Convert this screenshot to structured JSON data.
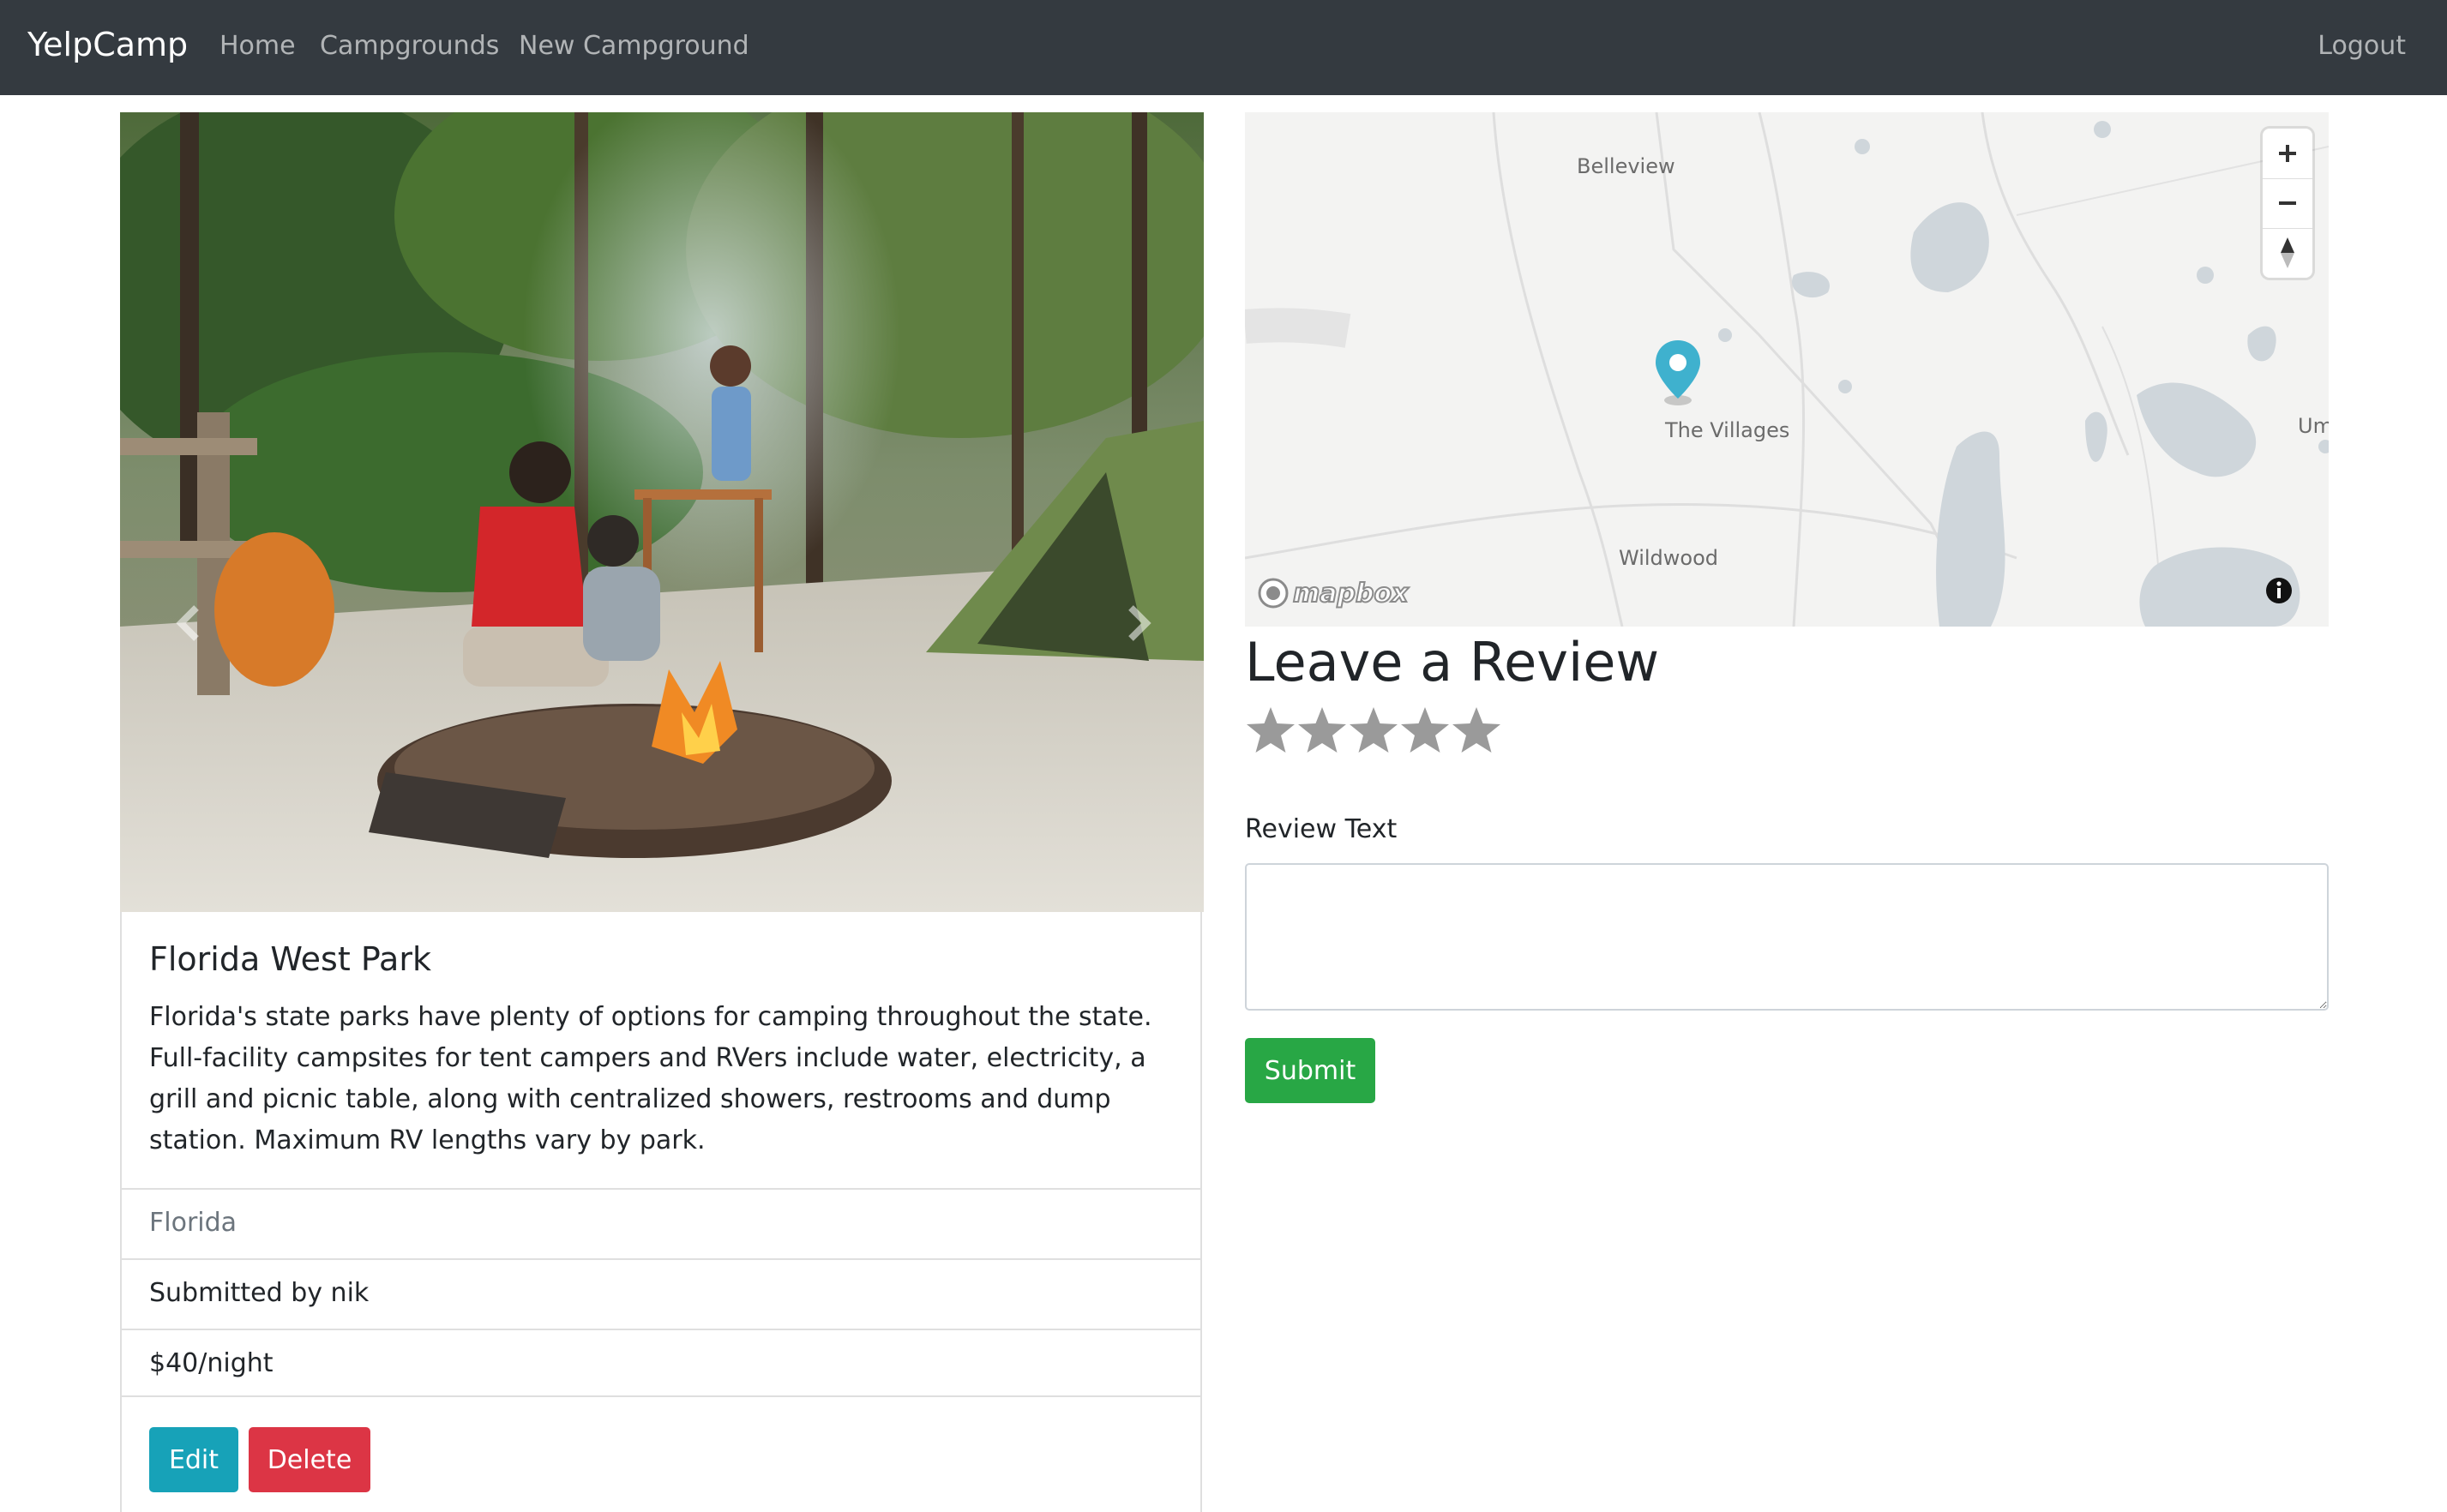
{
  "navbar": {
    "brand": "YelpCamp",
    "links": [
      "Home",
      "Campgrounds",
      "New Campground"
    ],
    "logout": "Logout"
  },
  "campground": {
    "title": "Florida West Park",
    "description": "Florida's state parks have plenty of options for camping throughout the state. Full-facility campsites for tent campers and RVers include water, electricity, a grill and picnic table, along with centralized showers, restrooms and dump station. Maximum RV lengths vary by park.",
    "location": "Florida",
    "submitted_by": "Submitted by nik",
    "price": "$40/night",
    "edit_label": "Edit",
    "delete_label": "Delete",
    "carousel": {
      "prev_icon": "chevron-left-icon",
      "next_icon": "chevron-right-icon"
    }
  },
  "map": {
    "labels": [
      "Belleview",
      "The Villages",
      "Wildwood",
      "Um"
    ],
    "logo_text": "mapbox",
    "controls": [
      "zoom-in-icon",
      "zoom-out-icon",
      "compass-icon"
    ],
    "marker_color": "#3fb1ce"
  },
  "review": {
    "heading": "Leave a Review",
    "rating_stars": 5,
    "text_label": "Review Text",
    "text_value": "",
    "submit_label": "Submit"
  },
  "colors": {
    "navbar": "#343a40",
    "edit": "#17a2b8",
    "delete": "#dc3545",
    "submit": "#28a745",
    "star": "#9a9a9a"
  }
}
